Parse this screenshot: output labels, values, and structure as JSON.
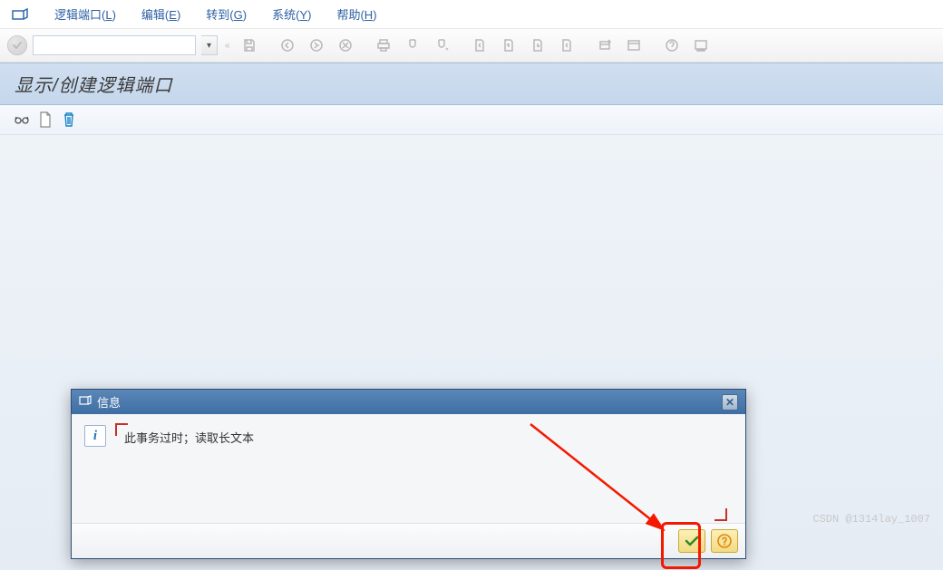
{
  "menubar": {
    "items": [
      {
        "label_prefix": "逻辑端口(",
        "hotkey": "L",
        "label_suffix": ")"
      },
      {
        "label_prefix": "编辑(",
        "hotkey": "E",
        "label_suffix": ")"
      },
      {
        "label_prefix": "转到(",
        "hotkey": "G",
        "label_suffix": ")"
      },
      {
        "label_prefix": "系统(",
        "hotkey": "Y",
        "label_suffix": ")"
      },
      {
        "label_prefix": "帮助(",
        "hotkey": "H",
        "label_suffix": ")"
      }
    ]
  },
  "toolbar": {
    "tcode_value": "",
    "expand_marker": "«"
  },
  "page": {
    "title": "显示/创建逻辑端口"
  },
  "modal": {
    "title": "信息",
    "message": "此事务过时；读取长文本"
  },
  "watermark": "CSDN @1314lay_1007"
}
